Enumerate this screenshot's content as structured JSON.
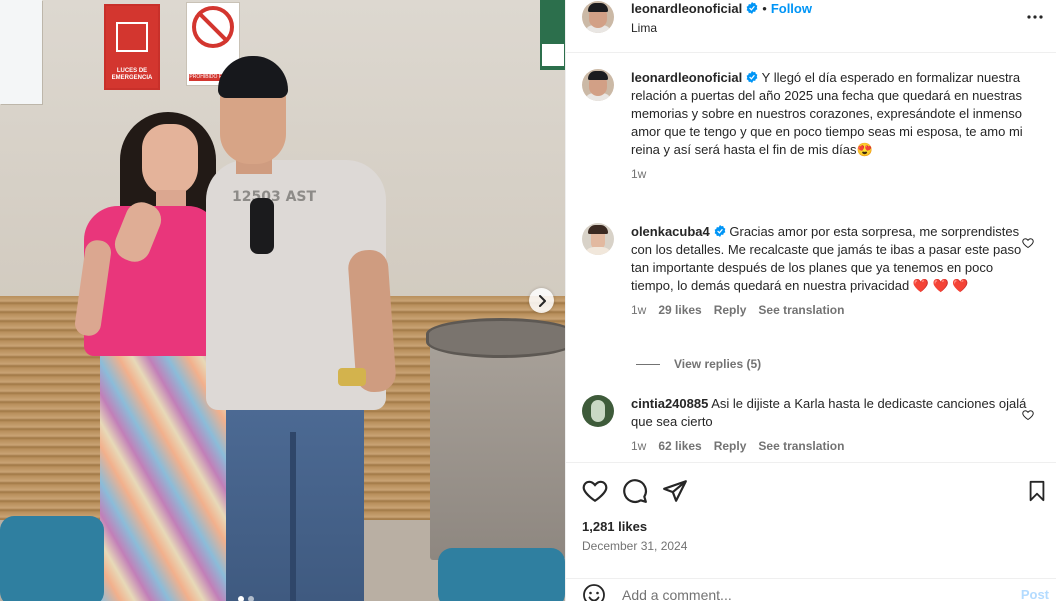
{
  "header": {
    "username": "leonardleonoficial",
    "separator": "•",
    "follow_label": "Follow",
    "location": "Lima"
  },
  "caption": {
    "username": "leonardleonoficial",
    "text": "Y llegó el día esperado en formalizar nuestra relación a puertas del año 2025 una fecha que quedará en nuestras memorias y sobre en nuestros corazones, expresándote el inmenso amor que te tengo y que en poco tiempo seas mi esposa, te amo mi reina y así será hasta el fin de mis días😍",
    "time": "1w"
  },
  "comments": [
    {
      "username": "olenkacuba4",
      "verified": true,
      "text": "Gracias amor por esta sorpresa, me sorprendistes con los detalles. Me recalcaste que jamás te ibas a pasar este paso tan importante después de los planes que ya tenemos en poco tiempo, lo demás quedará en nuestra privacidad ❤️ ❤️ ❤️",
      "time": "1w",
      "likes": "29 likes",
      "reply": "Reply",
      "translate": "See translation"
    },
    {
      "username": "cintia240885",
      "verified": false,
      "text": "Asi le dijiste a Karla hasta le dedicaste canciones ojalá que sea cierto",
      "time": "1w",
      "likes": "62 likes",
      "reply": "Reply",
      "translate": "See translation"
    }
  ],
  "view_replies": "View replies (5)",
  "photo": {
    "sign_emergency": "LUCES DE EMERGENCIA",
    "sign_smoking": "PROHIBIDO FUMAR",
    "shirt_print": "12503 AST"
  },
  "actions": {
    "likes": "1,281 likes",
    "date": "December 31, 2024"
  },
  "comment_bar": {
    "placeholder": "Add a comment...",
    "post_label": "Post"
  },
  "colors": {
    "accent": "#0095f6",
    "text": "#262626",
    "muted": "#737373",
    "heart_red": "#ed4956"
  }
}
